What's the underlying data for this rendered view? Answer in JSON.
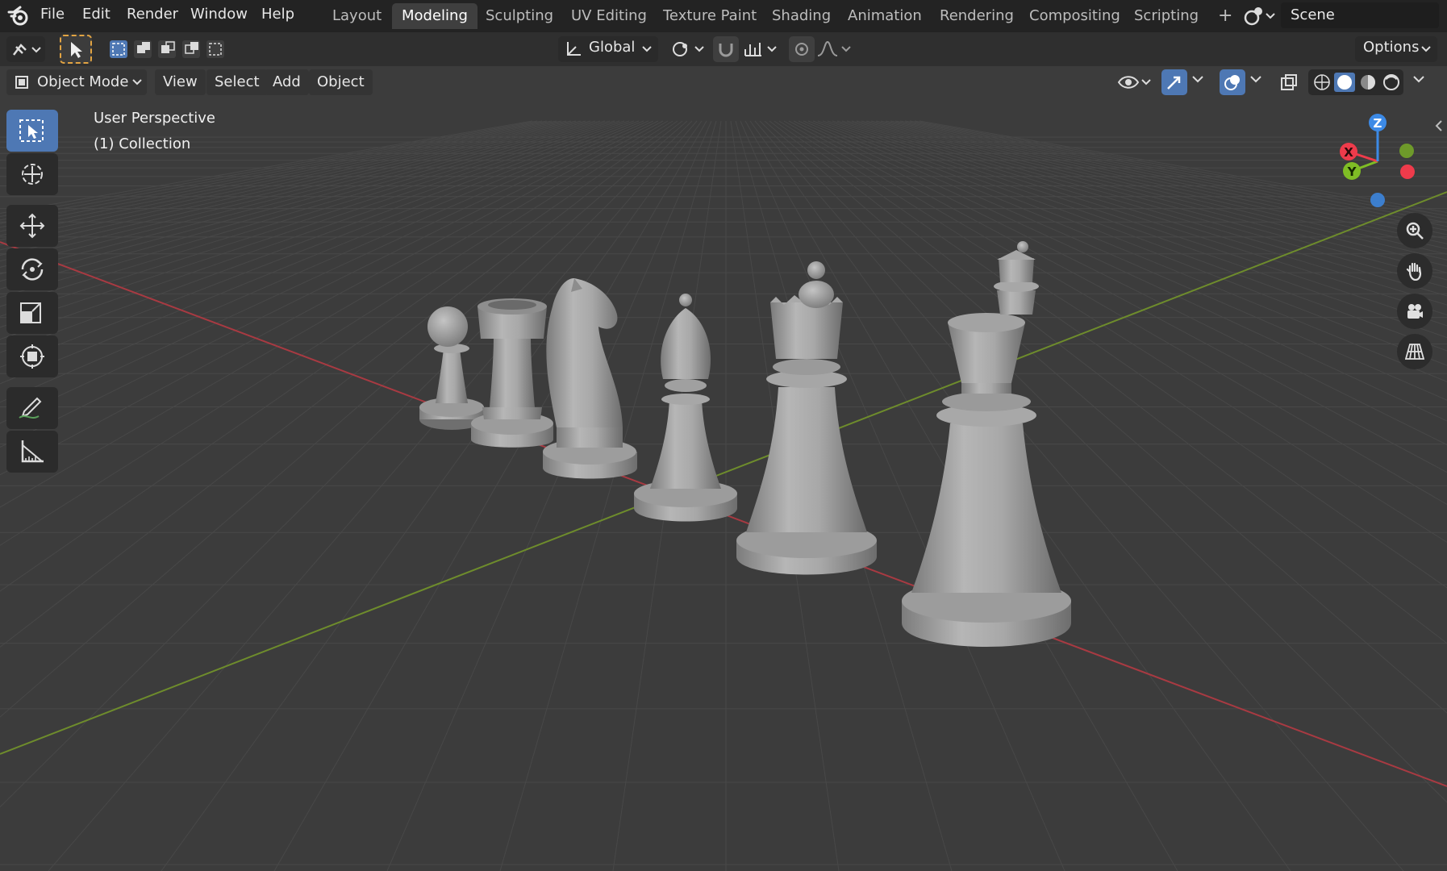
{
  "menubar": {
    "items": [
      "File",
      "Edit",
      "Render",
      "Window",
      "Help"
    ]
  },
  "workspaces": {
    "tabs": [
      "Layout",
      "Modeling",
      "Sculpting",
      "UV Editing",
      "Texture Paint",
      "Shading",
      "Animation",
      "Rendering",
      "Compositing",
      "Scripting"
    ],
    "active": "Modeling",
    "add_label": "+"
  },
  "scene": {
    "name": "Scene"
  },
  "tool_header": {
    "transform_orientation": "Global",
    "options_label": "Options"
  },
  "viewport_header": {
    "mode": "Object Mode",
    "menus": [
      "View",
      "Select",
      "Add",
      "Object"
    ]
  },
  "viewport_overlay": {
    "view_name": "User Perspective",
    "collection": "(1) Collection"
  },
  "gizmo": {
    "z": "Z",
    "x": "X",
    "y": "Y"
  },
  "toolbar": {
    "tools": [
      "select-box-icon",
      "cursor-icon",
      "move-icon",
      "rotate-icon",
      "scale-icon",
      "transform-icon",
      "annotate-icon",
      "measure-icon"
    ],
    "active_index": 0
  },
  "navigation": {
    "buttons": [
      "zoom-icon",
      "pan-hand-icon",
      "camera-view-icon",
      "perspective-grid-icon"
    ]
  },
  "colors": {
    "active_tool": "#4e78b4",
    "axis_x": "#ee3b4b",
    "axis_y": "#7fbd25",
    "axis_z": "#3c8ae6"
  }
}
